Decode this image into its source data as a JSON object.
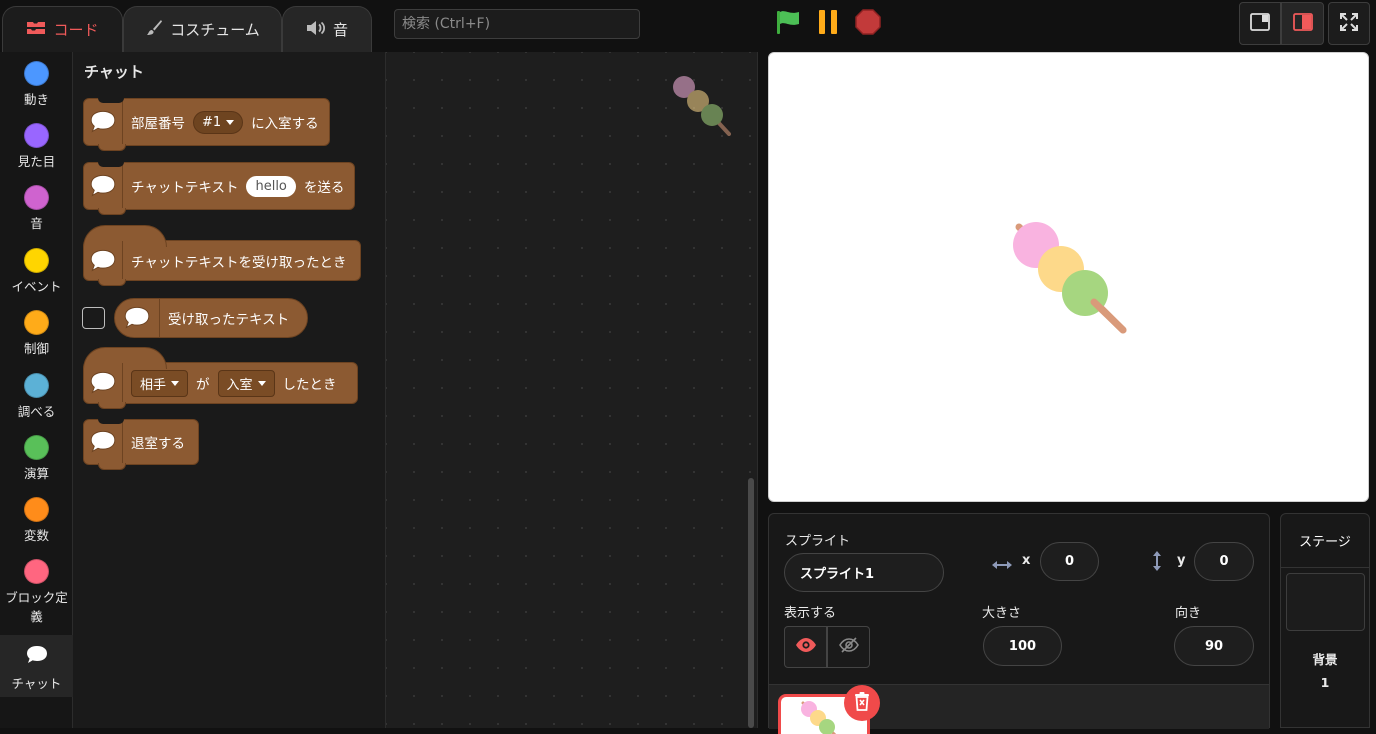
{
  "tabs": {
    "code": "コード",
    "costume": "コスチューム",
    "sound": "音"
  },
  "search": {
    "placeholder": "検索 (Ctrl+F)"
  },
  "controls": {
    "green_flag": "green-flag-icon",
    "pause": "pause-icon",
    "stop": "stop-icon"
  },
  "categories": [
    {
      "label": "動き",
      "color": "#4c97ff"
    },
    {
      "label": "見た目",
      "color": "#9966ff"
    },
    {
      "label": "音",
      "color": "#cf63cf"
    },
    {
      "label": "イベント",
      "color": "#ffd500"
    },
    {
      "label": "制御",
      "color": "#ffab19"
    },
    {
      "label": "調べる",
      "color": "#5cb1d6"
    },
    {
      "label": "演算",
      "color": "#59c059"
    },
    {
      "label": "変数",
      "color": "#ff8c1a"
    },
    {
      "label": "ブロック定義",
      "color": "#ff6680"
    },
    {
      "label": "チャット",
      "icon": "speech-bubble-icon"
    }
  ],
  "palette": {
    "heading": "チャット",
    "block_color": "#8c5a32",
    "blocks": {
      "enter_room": {
        "prefix": "部屋番号",
        "value": "#1",
        "suffix": "に入室する"
      },
      "send_text": {
        "prefix": "チャットテキスト",
        "value": "hello",
        "suffix": "を送る"
      },
      "when_received": {
        "label": "チャットテキストを受け取ったとき"
      },
      "received_text": {
        "label": "受け取ったテキスト"
      },
      "when_partner": {
        "who": "相手",
        "ga": "が",
        "action": "入室",
        "suffix": "したとき"
      },
      "leave_room": {
        "label": "退室する"
      }
    }
  },
  "sprite": {
    "label": "スプライト",
    "name": "スプライト1",
    "x_label": "x",
    "x": "0",
    "y_label": "y",
    "y": "0",
    "show_label": "表示する",
    "size_label": "大きさ",
    "size": "100",
    "direction_label": "向き",
    "direction": "90"
  },
  "stage_panel": {
    "title": "ステージ",
    "backdrop_label": "背景",
    "backdrop_count": "1"
  },
  "colors": {
    "accent": "#f05a5a",
    "dango_pink": "#f9b3e0",
    "dango_yellow": "#fdd98a",
    "dango_green": "#a6d680",
    "stick": "#d99a7a"
  }
}
